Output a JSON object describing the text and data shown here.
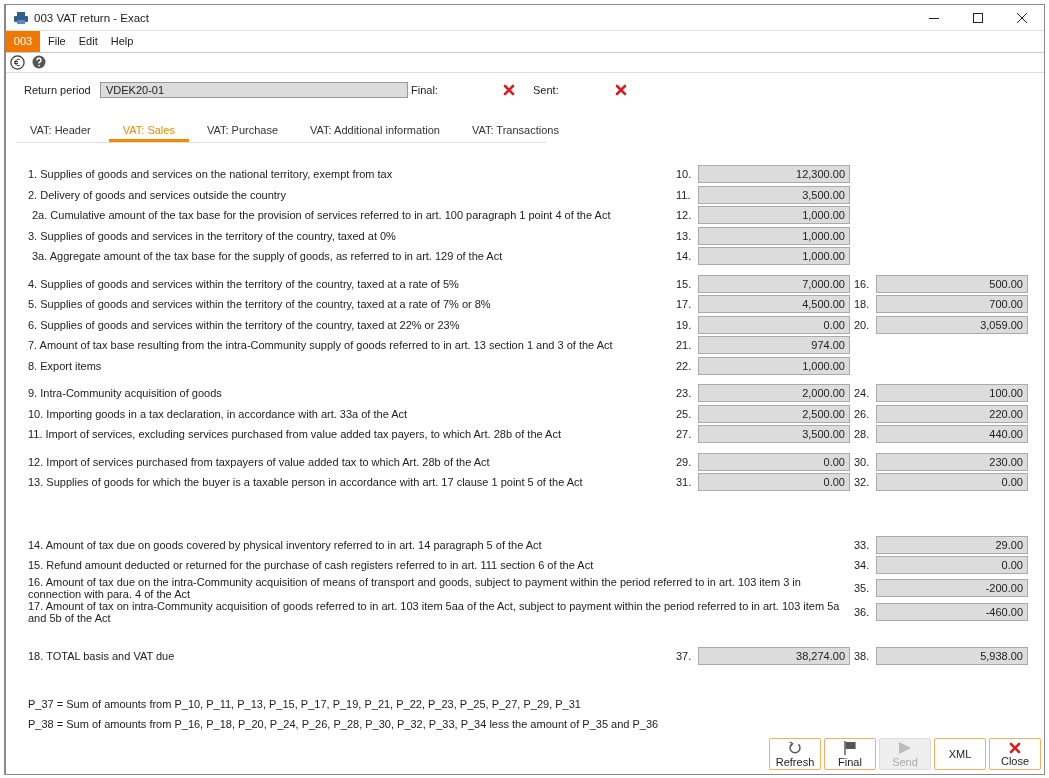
{
  "window": {
    "title": "003 VAT return - Exact"
  },
  "menu": {
    "badge": "003",
    "items": [
      "File",
      "Edit",
      "Help"
    ]
  },
  "header": {
    "return_period_label": "Return period",
    "return_period_value": "VDEK20-01",
    "final_label": "Final:",
    "final": false,
    "sent_label": "Sent:",
    "sent": false
  },
  "tabs": [
    {
      "label": "VAT: Header",
      "selected": false
    },
    {
      "label": "VAT: Sales",
      "selected": true
    },
    {
      "label": "VAT: Purchase",
      "selected": false
    },
    {
      "label": "VAT: Additional information",
      "selected": false
    },
    {
      "label": "VAT: Transactions",
      "selected": false
    }
  ],
  "groups": [
    {
      "kind": "normal",
      "rows": [
        {
          "kind": "main",
          "label": "1. Supplies of goods and services on the national territory, exempt from tax",
          "base": {
            "code": "10.",
            "value": "12,300.00"
          }
        },
        {
          "kind": "main",
          "label": "2. Delivery of goods and services outside the country",
          "base": {
            "code": "11.",
            "value": "3,500.00"
          }
        },
        {
          "kind": "sub",
          "label": "2a. Cumulative amount of the tax base for the provision of services referred to in art. 100 paragraph 1 point 4 of the Act",
          "base": {
            "code": "12.",
            "value": "1,000.00"
          }
        },
        {
          "kind": "main",
          "label": "3. Supplies of goods and services in the territory of the country, taxed at 0%",
          "base": {
            "code": "13.",
            "value": "1,000.00"
          }
        },
        {
          "kind": "sub",
          "label": "3a. Aggregate amount of the tax base for the supply of goods, as referred to in art. 129 of the Act",
          "base": {
            "code": "14.",
            "value": "1,000.00"
          }
        }
      ]
    },
    {
      "kind": "normal",
      "rows": [
        {
          "kind": "main",
          "label": "4. Supplies of goods and services within the territory of the country, taxed at a rate of 5%",
          "base": {
            "code": "15.",
            "value": "7,000.00"
          },
          "tax": {
            "code": "16.",
            "value": "500.00"
          }
        },
        {
          "kind": "main",
          "label": "5. Supplies of goods and services within the territory of the country, taxed at a rate of 7% or 8%",
          "base": {
            "code": "17.",
            "value": "4,500.00"
          },
          "tax": {
            "code": "18.",
            "value": "700.00"
          }
        },
        {
          "kind": "main",
          "label": "6. Supplies of goods and services within the territory of the country, taxed at 22% or 23%",
          "base": {
            "code": "19.",
            "value": "0.00"
          },
          "tax": {
            "code": "20.",
            "value": "3,059.00"
          }
        },
        {
          "kind": "main",
          "label": "7. Amount of tax base resulting from the intra-Community supply of goods referred to in art. 13 section 1 and 3 of the Act",
          "base": {
            "code": "21.",
            "value": "974.00"
          }
        },
        {
          "kind": "main",
          "label": "8. Export items",
          "base": {
            "code": "22.",
            "value": "1,000.00"
          }
        }
      ]
    },
    {
      "kind": "normal",
      "rows": [
        {
          "kind": "main",
          "label": "9. Intra-Community acquisition of goods",
          "base": {
            "code": "23.",
            "value": "2,000.00"
          },
          "tax": {
            "code": "24.",
            "value": "100.00"
          }
        },
        {
          "kind": "main",
          "label": "10. Importing goods in a tax declaration, in accordance with art. 33a of the Act",
          "base": {
            "code": "25.",
            "value": "2,500.00"
          },
          "tax": {
            "code": "26.",
            "value": "220.00"
          }
        },
        {
          "kind": "main",
          "label": "11. Import of services, excluding services purchased from value added tax payers, to which Art. 28b of the Act",
          "base": {
            "code": "27.",
            "value": "3,500.00"
          },
          "tax": {
            "code": "28.",
            "value": "440.00"
          }
        }
      ]
    },
    {
      "kind": "normal",
      "rows": [
        {
          "kind": "main",
          "label": "12. Import of services purchased from taxpayers of value added tax to which Art. 28b of the Act",
          "base": {
            "code": "29.",
            "value": "0.00"
          },
          "tax": {
            "code": "30.",
            "value": "230.00"
          }
        },
        {
          "kind": "main",
          "label": "13. Supplies of goods for which the buyer is a taxable person in accordance with art. 17 clause 1 point 5 of the Act",
          "base": {
            "code": "31.",
            "value": "0.00"
          },
          "tax": {
            "code": "32.",
            "value": "0.00"
          }
        }
      ]
    },
    {
      "kind": "separated",
      "rows": [
        {
          "kind": "main",
          "label": "14. Amount of tax due on goods covered by physical inventory referred to in art. 14 paragraph 5 of the Act",
          "tax": {
            "code": "33.",
            "value": "29.00"
          }
        },
        {
          "kind": "main",
          "label": "15. Refund amount deducted or returned for the purchase of cash registers referred to in art. 111 section 6 of the Act",
          "tax": {
            "code": "34.",
            "value": "0.00"
          }
        },
        {
          "kind": "main",
          "label": "16. Amount of tax due on the intra-Community acquisition of means of transport and goods, subject to payment within the period referred to in art. 103 item 3 in connection with para. 4 of the Act",
          "tax": {
            "code": "35.",
            "value": "-200.00"
          }
        },
        {
          "kind": "main",
          "label": "17. Amount of tax on intra-Community acquisition of goods referred to in art. 103 item 5aa of the Act, subject to payment within the period referred to in art. 103 item 5a and 5b of the Act",
          "tax": {
            "code": "36.",
            "value": "-460.00"
          }
        }
      ]
    },
    {
      "kind": "spaced",
      "rows": [
        {
          "kind": "main",
          "label": "18. TOTAL basis and VAT due",
          "base": {
            "code": "37.",
            "value": "38,274.00"
          },
          "tax": {
            "code": "38.",
            "value": "5,938.00"
          }
        }
      ]
    }
  ],
  "notes": [
    "P_37 = Sum of amounts from P_10, P_11, P_13, P_15, P_17, P_19, P_21, P_22, P_23, P_25, P_27, P_29, P_31",
    "P_38 = Sum of amounts from P_16, P_18, P_20, P_24, P_26, P_28, P_30, P_32, P_33, P_34 less the amount of P_35 and P_36"
  ],
  "buttons": [
    {
      "kind": "refresh",
      "label": "Refresh",
      "disabled": false
    },
    {
      "kind": "flag",
      "label": "Final",
      "disabled": false
    },
    {
      "kind": "send",
      "label": "Send",
      "disabled": true
    },
    {
      "kind": "xml",
      "label": "XML",
      "disabled": false
    },
    {
      "kind": "close",
      "label": "Close",
      "disabled": false
    }
  ]
}
